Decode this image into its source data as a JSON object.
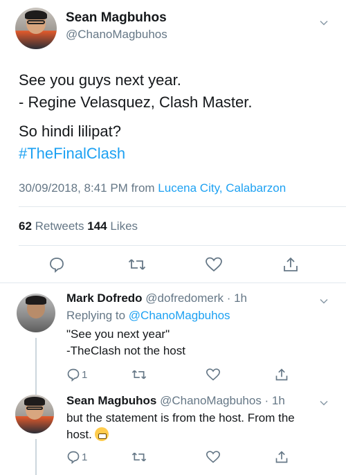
{
  "main_tweet": {
    "name": "Sean Magbuhos",
    "handle": "@ChanoMagbuhos",
    "lines": [
      "See you guys next year.",
      "- Regine Velasquez, Clash Master.",
      "So hindi lilipat?"
    ],
    "hashtag": "#TheFinalClash",
    "timestamp": "30/09/2018, 8:41 PM from ",
    "location": "Lucena City, Calabarzon",
    "retweets_count": "62",
    "retweets_label": " Retweets  ",
    "likes_count": "144",
    "likes_label": " Likes"
  },
  "replies": [
    {
      "name": "Mark Dofredo",
      "handle_time": " @dofredomerk · 1h",
      "replying_prefix": "Replying to ",
      "replying_to": "@ChanoMagbuhos",
      "line1": "\"See you next year\"",
      "line2": "-TheClash not the host",
      "reply_count": "1"
    },
    {
      "name": "Sean Magbuhos",
      "handle_time": " @ChanoMagbuhos · 1h",
      "line1": "but the statement is from the host. From the",
      "line2": "host.",
      "reply_count": "1"
    }
  ],
  "colors": {
    "accent": "#1da1f2",
    "secondary_text": "#657786",
    "divider": "#e1e8ed"
  }
}
